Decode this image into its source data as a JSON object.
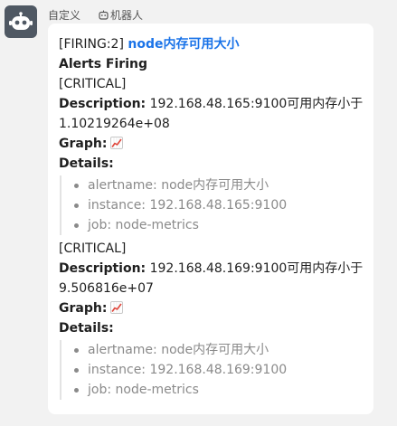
{
  "sender": {
    "name": "自定义",
    "tag": "机器人"
  },
  "message": {
    "prefix": "[FIRING:2]",
    "title": "node内存可用大小",
    "heading": "Alerts Firing",
    "alerts": [
      {
        "severity": "[CRITICAL]",
        "description_label": "Description:",
        "description": "192.168.48.165:9100可用内存小于1.10219264e+08",
        "graph_label": "Graph:",
        "details_label": "Details:",
        "details": [
          "alertname: node内存可用大小",
          "instance: 192.168.48.165:9100",
          "job: node-metrics"
        ]
      },
      {
        "severity": "[CRITICAL]",
        "description_label": "Description:",
        "description": "192.168.48.169:9100可用内存小于9.506816e+07",
        "graph_label": "Graph:",
        "details_label": "Details:",
        "details": [
          "alertname: node内存可用大小",
          "instance: 192.168.48.169:9100",
          "job: node-metrics"
        ]
      }
    ]
  },
  "icons": {
    "avatar": "robot-icon",
    "tag": "robot-tag-icon",
    "graph": "chart-increasing-icon"
  }
}
